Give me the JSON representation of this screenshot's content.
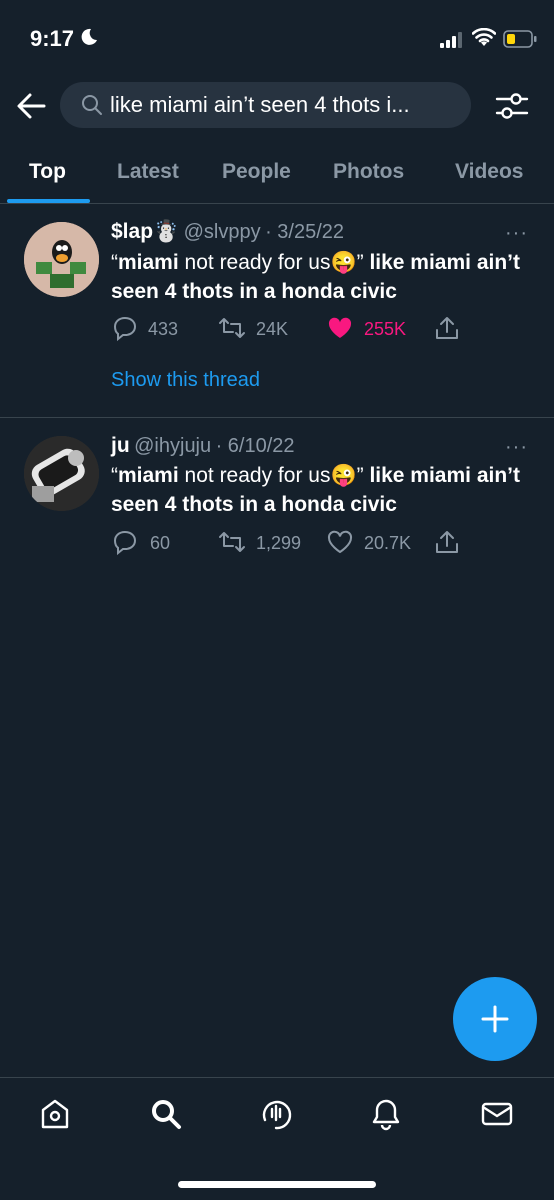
{
  "status_bar": {
    "time": "9:17"
  },
  "search": {
    "query": "like miami ain’t seen 4 thots i..."
  },
  "tabs": [
    {
      "label": "Top",
      "active": true
    },
    {
      "label": "Latest"
    },
    {
      "label": "People"
    },
    {
      "label": "Photos"
    },
    {
      "label": "Videos"
    }
  ],
  "tweets": [
    {
      "name": "$lap☃️",
      "handle": "@slvppy",
      "date": "· 3/25/22",
      "body_open": "“",
      "body_bold1": "miami",
      "body_mid": " not ready for us😜” ",
      "body_bold2": "like miami ain’t seen 4 thots in a honda civic",
      "replies": "433",
      "retweets": "24K",
      "likes": "255K",
      "liked": true,
      "thread_link": "Show this thread"
    },
    {
      "name": "ju",
      "handle": "@ihyjuju",
      "date": "· 6/10/22",
      "body_open": "“",
      "body_bold1": "miami",
      "body_mid": " not ready for us😜” ",
      "body_bold2": "like miami ain’t seen 4 thots in a honda civic",
      "replies": "60",
      "retweets": "1,299",
      "likes": "20.7K",
      "liked": false
    }
  ],
  "colors": {
    "background": "#15202b",
    "accent": "#1d9bf0",
    "like": "#f91880",
    "muted": "#8b98a5"
  },
  "bottom_nav": [
    "home-icon",
    "search-icon",
    "spaces-icon",
    "notifications-icon",
    "messages-icon"
  ]
}
